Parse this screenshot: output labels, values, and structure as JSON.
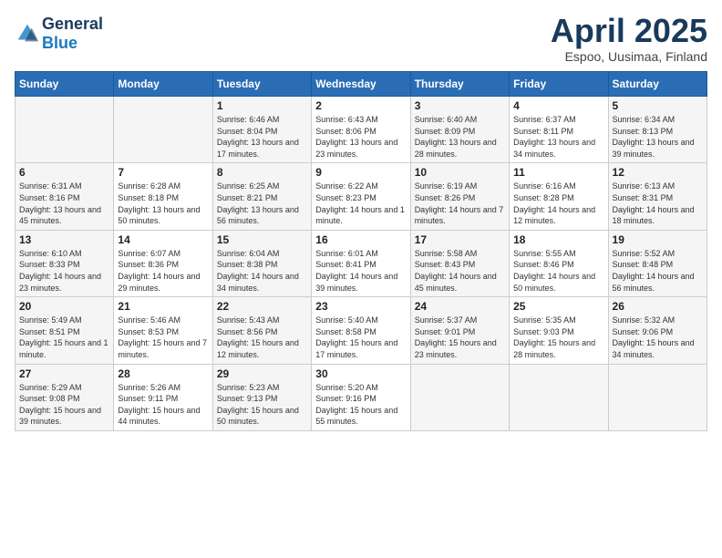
{
  "header": {
    "logo_general": "General",
    "logo_blue": "Blue",
    "month": "April 2025",
    "location": "Espoo, Uusimaa, Finland"
  },
  "weekdays": [
    "Sunday",
    "Monday",
    "Tuesday",
    "Wednesday",
    "Thursday",
    "Friday",
    "Saturday"
  ],
  "weeks": [
    [
      {
        "day": "",
        "info": ""
      },
      {
        "day": "",
        "info": ""
      },
      {
        "day": "1",
        "info": "Sunrise: 6:46 AM\nSunset: 8:04 PM\nDaylight: 13 hours and 17 minutes."
      },
      {
        "day": "2",
        "info": "Sunrise: 6:43 AM\nSunset: 8:06 PM\nDaylight: 13 hours and 23 minutes."
      },
      {
        "day": "3",
        "info": "Sunrise: 6:40 AM\nSunset: 8:09 PM\nDaylight: 13 hours and 28 minutes."
      },
      {
        "day": "4",
        "info": "Sunrise: 6:37 AM\nSunset: 8:11 PM\nDaylight: 13 hours and 34 minutes."
      },
      {
        "day": "5",
        "info": "Sunrise: 6:34 AM\nSunset: 8:13 PM\nDaylight: 13 hours and 39 minutes."
      }
    ],
    [
      {
        "day": "6",
        "info": "Sunrise: 6:31 AM\nSunset: 8:16 PM\nDaylight: 13 hours and 45 minutes."
      },
      {
        "day": "7",
        "info": "Sunrise: 6:28 AM\nSunset: 8:18 PM\nDaylight: 13 hours and 50 minutes."
      },
      {
        "day": "8",
        "info": "Sunrise: 6:25 AM\nSunset: 8:21 PM\nDaylight: 13 hours and 56 minutes."
      },
      {
        "day": "9",
        "info": "Sunrise: 6:22 AM\nSunset: 8:23 PM\nDaylight: 14 hours and 1 minute."
      },
      {
        "day": "10",
        "info": "Sunrise: 6:19 AM\nSunset: 8:26 PM\nDaylight: 14 hours and 7 minutes."
      },
      {
        "day": "11",
        "info": "Sunrise: 6:16 AM\nSunset: 8:28 PM\nDaylight: 14 hours and 12 minutes."
      },
      {
        "day": "12",
        "info": "Sunrise: 6:13 AM\nSunset: 8:31 PM\nDaylight: 14 hours and 18 minutes."
      }
    ],
    [
      {
        "day": "13",
        "info": "Sunrise: 6:10 AM\nSunset: 8:33 PM\nDaylight: 14 hours and 23 minutes."
      },
      {
        "day": "14",
        "info": "Sunrise: 6:07 AM\nSunset: 8:36 PM\nDaylight: 14 hours and 29 minutes."
      },
      {
        "day": "15",
        "info": "Sunrise: 6:04 AM\nSunset: 8:38 PM\nDaylight: 14 hours and 34 minutes."
      },
      {
        "day": "16",
        "info": "Sunrise: 6:01 AM\nSunset: 8:41 PM\nDaylight: 14 hours and 39 minutes."
      },
      {
        "day": "17",
        "info": "Sunrise: 5:58 AM\nSunset: 8:43 PM\nDaylight: 14 hours and 45 minutes."
      },
      {
        "day": "18",
        "info": "Sunrise: 5:55 AM\nSunset: 8:46 PM\nDaylight: 14 hours and 50 minutes."
      },
      {
        "day": "19",
        "info": "Sunrise: 5:52 AM\nSunset: 8:48 PM\nDaylight: 14 hours and 56 minutes."
      }
    ],
    [
      {
        "day": "20",
        "info": "Sunrise: 5:49 AM\nSunset: 8:51 PM\nDaylight: 15 hours and 1 minute."
      },
      {
        "day": "21",
        "info": "Sunrise: 5:46 AM\nSunset: 8:53 PM\nDaylight: 15 hours and 7 minutes."
      },
      {
        "day": "22",
        "info": "Sunrise: 5:43 AM\nSunset: 8:56 PM\nDaylight: 15 hours and 12 minutes."
      },
      {
        "day": "23",
        "info": "Sunrise: 5:40 AM\nSunset: 8:58 PM\nDaylight: 15 hours and 17 minutes."
      },
      {
        "day": "24",
        "info": "Sunrise: 5:37 AM\nSunset: 9:01 PM\nDaylight: 15 hours and 23 minutes."
      },
      {
        "day": "25",
        "info": "Sunrise: 5:35 AM\nSunset: 9:03 PM\nDaylight: 15 hours and 28 minutes."
      },
      {
        "day": "26",
        "info": "Sunrise: 5:32 AM\nSunset: 9:06 PM\nDaylight: 15 hours and 34 minutes."
      }
    ],
    [
      {
        "day": "27",
        "info": "Sunrise: 5:29 AM\nSunset: 9:08 PM\nDaylight: 15 hours and 39 minutes."
      },
      {
        "day": "28",
        "info": "Sunrise: 5:26 AM\nSunset: 9:11 PM\nDaylight: 15 hours and 44 minutes."
      },
      {
        "day": "29",
        "info": "Sunrise: 5:23 AM\nSunset: 9:13 PM\nDaylight: 15 hours and 50 minutes."
      },
      {
        "day": "30",
        "info": "Sunrise: 5:20 AM\nSunset: 9:16 PM\nDaylight: 15 hours and 55 minutes."
      },
      {
        "day": "",
        "info": ""
      },
      {
        "day": "",
        "info": ""
      },
      {
        "day": "",
        "info": ""
      }
    ]
  ]
}
